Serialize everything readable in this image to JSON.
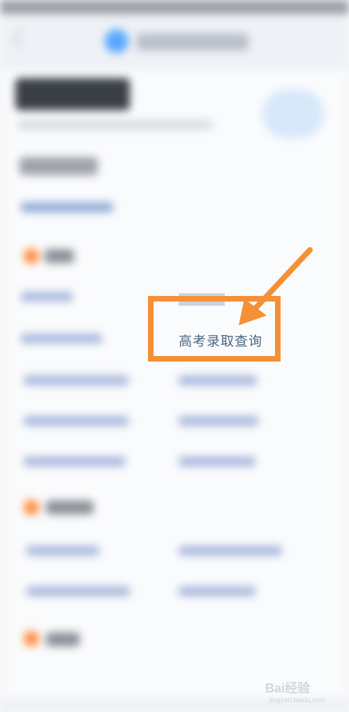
{
  "highlight": {
    "label": "高考录取查询",
    "color": "#f59037"
  },
  "watermark": {
    "brand": "Bai经验",
    "url": "jingyan.baidu.com"
  },
  "icons": {
    "back": "back-arrow-icon",
    "app_logo": "app-logo-icon",
    "pointer_arrow": "pointer-arrow-icon"
  },
  "colors": {
    "accent": "#f59037",
    "section_dot": "#ff8a3b",
    "link": "#4a6586"
  }
}
